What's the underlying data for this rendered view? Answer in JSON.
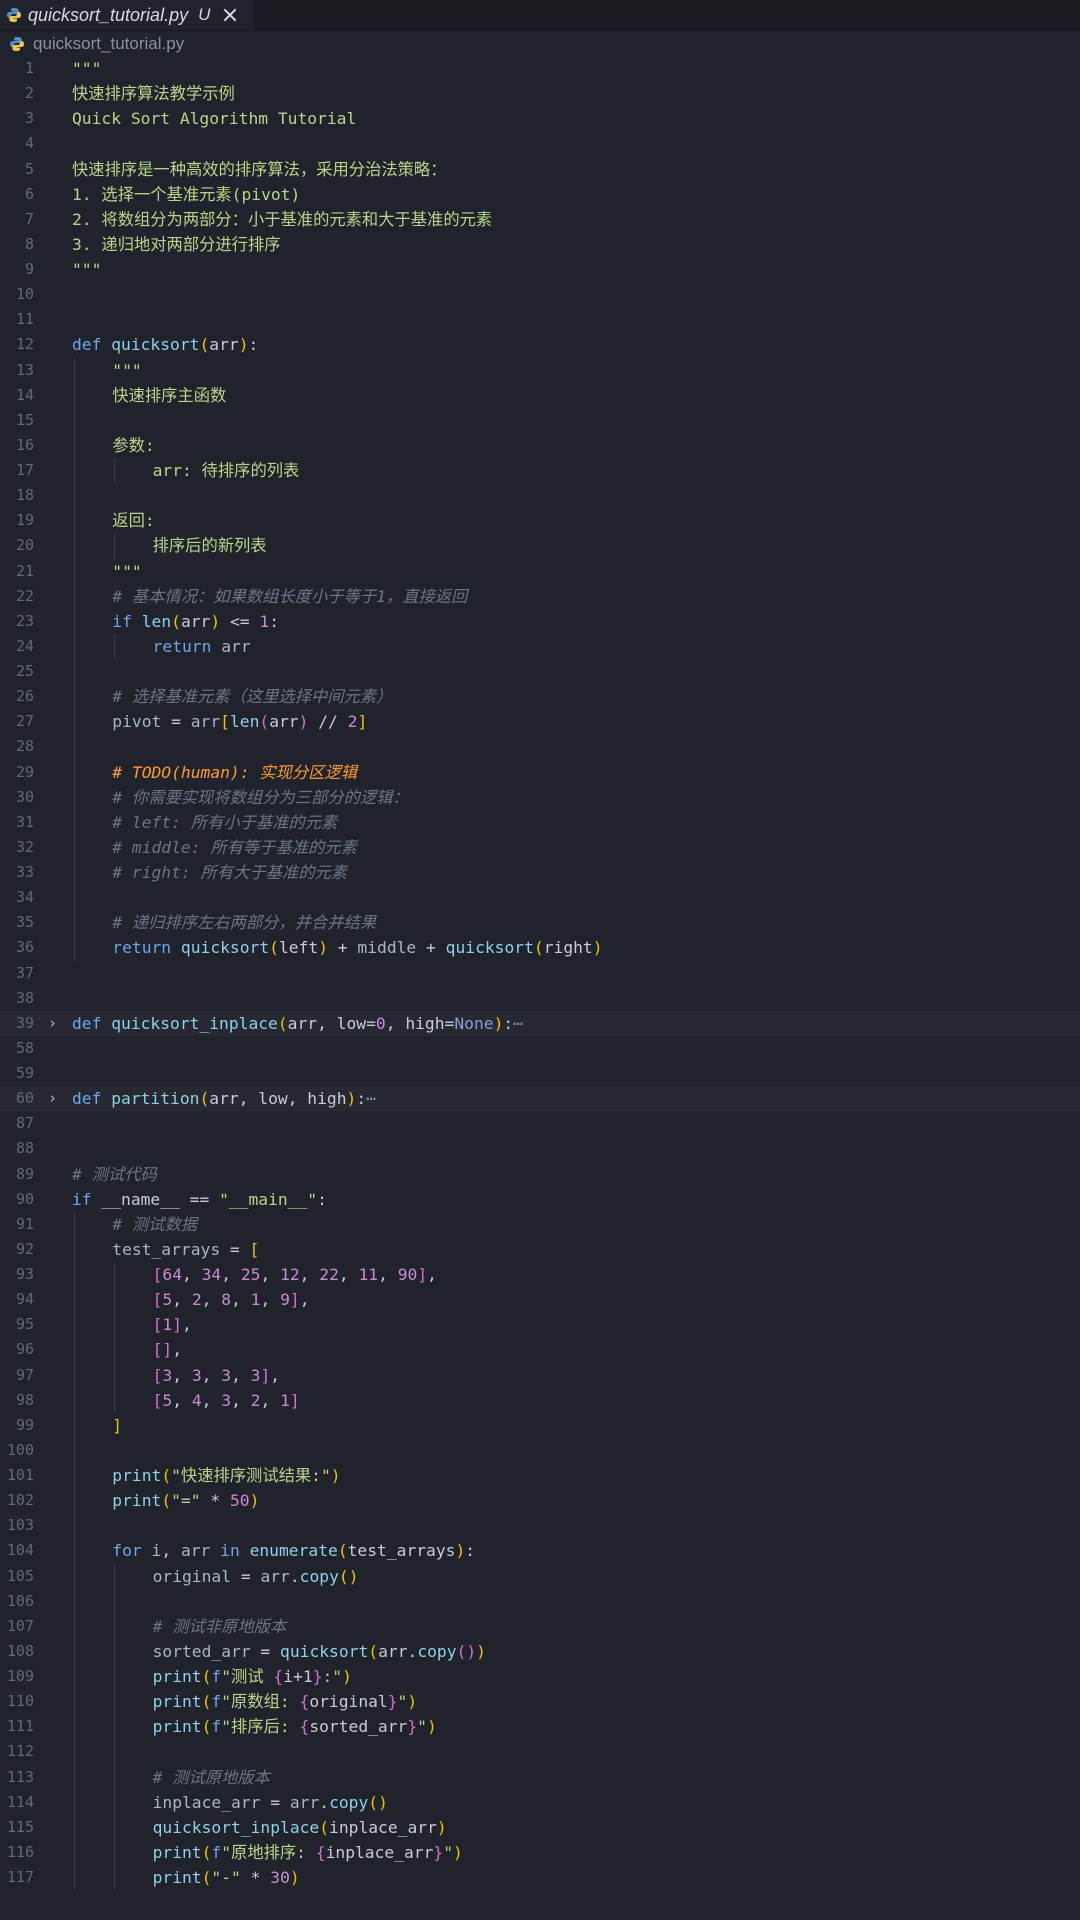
{
  "tab": {
    "filename": "quicksort_tutorial.py",
    "status": "U"
  },
  "breadcrumb": {
    "file": "quicksort_tutorial.py"
  },
  "colors": {
    "background": "#20232b",
    "keyword": "#6fa6e8",
    "function": "#8fd1e6",
    "string": "#b9d58a",
    "number": "#c98bd4",
    "comment": "#6d7587",
    "todo": "#ff9a2e",
    "bracket_level1": "#f0c400",
    "bracket_level2": "#d66fd2"
  },
  "lines": [
    {
      "n": "1",
      "indent": 0,
      "tokens": [
        [
          "str",
          "\"\"\""
        ]
      ]
    },
    {
      "n": "2",
      "indent": 0,
      "tokens": [
        [
          "str",
          "快速排序算法教学示例"
        ]
      ]
    },
    {
      "n": "3",
      "indent": 0,
      "tokens": [
        [
          "str",
          "Quick Sort Algorithm Tutorial"
        ]
      ]
    },
    {
      "n": "4",
      "indent": 0,
      "tokens": []
    },
    {
      "n": "5",
      "indent": 0,
      "tokens": [
        [
          "str",
          "快速排序是一种高效的排序算法，采用分治法策略："
        ]
      ]
    },
    {
      "n": "6",
      "indent": 0,
      "tokens": [
        [
          "str",
          "1. 选择一个基准元素(pivot)"
        ]
      ]
    },
    {
      "n": "7",
      "indent": 0,
      "tokens": [
        [
          "str",
          "2. 将数组分为两部分：小于基准的元素和大于基准的元素"
        ]
      ]
    },
    {
      "n": "8",
      "indent": 0,
      "tokens": [
        [
          "str",
          "3. 递归地对两部分进行排序"
        ]
      ]
    },
    {
      "n": "9",
      "indent": 0,
      "tokens": [
        [
          "str",
          "\"\"\""
        ]
      ]
    },
    {
      "n": "10",
      "indent": 0,
      "tokens": []
    },
    {
      "n": "11",
      "indent": 0,
      "tokens": []
    },
    {
      "n": "12",
      "indent": 0,
      "tokens": [
        [
          "kw",
          "def "
        ],
        [
          "fn",
          "quicksort"
        ],
        [
          "b1",
          "("
        ],
        [
          "id",
          "arr"
        ],
        [
          "b1",
          ")"
        ],
        [
          "id",
          ":"
        ]
      ]
    },
    {
      "n": "13",
      "indent": 1,
      "tokens": [
        [
          "str",
          "\"\"\""
        ]
      ]
    },
    {
      "n": "14",
      "indent": 1,
      "tokens": [
        [
          "str",
          "快速排序主函数"
        ]
      ]
    },
    {
      "n": "15",
      "indent": 1,
      "tokens": []
    },
    {
      "n": "16",
      "indent": 1,
      "tokens": [
        [
          "str",
          "参数:"
        ]
      ]
    },
    {
      "n": "17",
      "indent": 2,
      "tokens": [
        [
          "str",
          "arr: 待排序的列表"
        ]
      ]
    },
    {
      "n": "18",
      "indent": 1,
      "tokens": []
    },
    {
      "n": "19",
      "indent": 1,
      "tokens": [
        [
          "str",
          "返回:"
        ]
      ]
    },
    {
      "n": "20",
      "indent": 2,
      "tokens": [
        [
          "str",
          "排序后的新列表"
        ]
      ]
    },
    {
      "n": "21",
      "indent": 1,
      "tokens": [
        [
          "str",
          "\"\"\""
        ]
      ]
    },
    {
      "n": "22",
      "indent": 1,
      "tokens": [
        [
          "cm",
          "# 基本情况：如果数组长度小于等于1，直接返回"
        ]
      ]
    },
    {
      "n": "23",
      "indent": 1,
      "tokens": [
        [
          "kw",
          "if "
        ],
        [
          "fn",
          "len"
        ],
        [
          "b1",
          "("
        ],
        [
          "id",
          "arr"
        ],
        [
          "b1",
          ")"
        ],
        [
          "op",
          " <= "
        ],
        [
          "num",
          "1"
        ],
        [
          "id",
          ":"
        ]
      ]
    },
    {
      "n": "24",
      "indent": 2,
      "tokens": [
        [
          "kw",
          "return "
        ],
        [
          "var",
          "arr"
        ]
      ]
    },
    {
      "n": "25",
      "indent": 1,
      "tokens": []
    },
    {
      "n": "26",
      "indent": 1,
      "tokens": [
        [
          "cm",
          "# 选择基准元素（这里选择中间元素）"
        ]
      ]
    },
    {
      "n": "27",
      "indent": 1,
      "tokens": [
        [
          "var",
          "pivot"
        ],
        [
          "op",
          " = "
        ],
        [
          "var",
          "arr"
        ],
        [
          "b1",
          "["
        ],
        [
          "fn",
          "len"
        ],
        [
          "b2",
          "("
        ],
        [
          "id",
          "arr"
        ],
        [
          "b2",
          ")"
        ],
        [
          "op",
          " // "
        ],
        [
          "num",
          "2"
        ],
        [
          "b1",
          "]"
        ]
      ]
    },
    {
      "n": "28",
      "indent": 1,
      "tokens": []
    },
    {
      "n": "29",
      "indent": 1,
      "tokens": [
        [
          "todo",
          "# TODO(human): 实现分区逻辑"
        ]
      ]
    },
    {
      "n": "30",
      "indent": 1,
      "tokens": [
        [
          "cm",
          "# 你需要实现将数组分为三部分的逻辑："
        ]
      ]
    },
    {
      "n": "31",
      "indent": 1,
      "tokens": [
        [
          "cm",
          "# left: 所有小于基准的元素"
        ]
      ]
    },
    {
      "n": "32",
      "indent": 1,
      "tokens": [
        [
          "cm",
          "# middle: 所有等于基准的元素"
        ]
      ]
    },
    {
      "n": "33",
      "indent": 1,
      "tokens": [
        [
          "cm",
          "# right: 所有大于基准的元素"
        ]
      ]
    },
    {
      "n": "34",
      "indent": 1,
      "tokens": []
    },
    {
      "n": "35",
      "indent": 1,
      "tokens": [
        [
          "cm",
          "# 递归排序左右两部分，并合并结果"
        ]
      ]
    },
    {
      "n": "36",
      "indent": 1,
      "tokens": [
        [
          "kw",
          "return "
        ],
        [
          "fn",
          "quicksort"
        ],
        [
          "b1",
          "("
        ],
        [
          "id",
          "left"
        ],
        [
          "b1",
          ")"
        ],
        [
          "op",
          " + "
        ],
        [
          "var",
          "middle"
        ],
        [
          "op",
          " + "
        ],
        [
          "fn",
          "quicksort"
        ],
        [
          "b1",
          "("
        ],
        [
          "id",
          "right"
        ],
        [
          "b1",
          ")"
        ]
      ]
    },
    {
      "n": "37",
      "indent": 0,
      "tokens": []
    },
    {
      "n": "38",
      "indent": 0,
      "tokens": []
    },
    {
      "n": "39",
      "indent": 0,
      "fold": true,
      "hl": true,
      "tokens": [
        [
          "kw",
          "def "
        ],
        [
          "fn",
          "quicksort_inplace"
        ],
        [
          "b1",
          "("
        ],
        [
          "id",
          "arr, low"
        ],
        [
          "op",
          "="
        ],
        [
          "num",
          "0"
        ],
        [
          "id",
          ", high"
        ],
        [
          "op",
          "="
        ],
        [
          "none",
          "None"
        ],
        [
          "b1",
          ")"
        ],
        [
          "id",
          ":"
        ],
        [
          "dots",
          "⋯"
        ]
      ]
    },
    {
      "n": "58",
      "indent": 0,
      "tokens": []
    },
    {
      "n": "59",
      "indent": 0,
      "tokens": []
    },
    {
      "n": "60",
      "indent": 0,
      "fold": true,
      "hl": true,
      "tokens": [
        [
          "kw",
          "def "
        ],
        [
          "fn",
          "partition"
        ],
        [
          "b1",
          "("
        ],
        [
          "id",
          "arr, low, high"
        ],
        [
          "b1",
          ")"
        ],
        [
          "id",
          ":"
        ],
        [
          "dots",
          "⋯"
        ]
      ]
    },
    {
      "n": "87",
      "indent": 0,
      "tokens": []
    },
    {
      "n": "88",
      "indent": 0,
      "tokens": []
    },
    {
      "n": "89",
      "indent": 0,
      "tokens": [
        [
          "cm",
          "# 测试代码"
        ]
      ]
    },
    {
      "n": "90",
      "indent": 0,
      "tokens": [
        [
          "kw",
          "if "
        ],
        [
          "id",
          "__name__"
        ],
        [
          "op",
          " == "
        ],
        [
          "str",
          "\"__main__\""
        ],
        [
          "id",
          ":"
        ]
      ]
    },
    {
      "n": "91",
      "indent": 1,
      "tokens": [
        [
          "cm",
          "# 测试数据"
        ]
      ]
    },
    {
      "n": "92",
      "indent": 1,
      "tokens": [
        [
          "var",
          "test_arrays"
        ],
        [
          "op",
          " = "
        ],
        [
          "b1",
          "["
        ]
      ]
    },
    {
      "n": "93",
      "indent": 2,
      "tokens": [
        [
          "b2",
          "["
        ],
        [
          "num",
          "64"
        ],
        [
          "id",
          ", "
        ],
        [
          "num",
          "34"
        ],
        [
          "id",
          ", "
        ],
        [
          "num",
          "25"
        ],
        [
          "id",
          ", "
        ],
        [
          "num",
          "12"
        ],
        [
          "id",
          ", "
        ],
        [
          "num",
          "22"
        ],
        [
          "id",
          ", "
        ],
        [
          "num",
          "11"
        ],
        [
          "id",
          ", "
        ],
        [
          "num",
          "90"
        ],
        [
          "b2",
          "]"
        ],
        [
          "id",
          ","
        ]
      ]
    },
    {
      "n": "94",
      "indent": 2,
      "tokens": [
        [
          "b2",
          "["
        ],
        [
          "num",
          "5"
        ],
        [
          "id",
          ", "
        ],
        [
          "num",
          "2"
        ],
        [
          "id",
          ", "
        ],
        [
          "num",
          "8"
        ],
        [
          "id",
          ", "
        ],
        [
          "num",
          "1"
        ],
        [
          "id",
          ", "
        ],
        [
          "num",
          "9"
        ],
        [
          "b2",
          "]"
        ],
        [
          "id",
          ","
        ]
      ]
    },
    {
      "n": "95",
      "indent": 2,
      "tokens": [
        [
          "b2",
          "["
        ],
        [
          "num",
          "1"
        ],
        [
          "b2",
          "]"
        ],
        [
          "id",
          ","
        ]
      ]
    },
    {
      "n": "96",
      "indent": 2,
      "tokens": [
        [
          "b2",
          "[]"
        ],
        [
          "id",
          ","
        ]
      ]
    },
    {
      "n": "97",
      "indent": 2,
      "tokens": [
        [
          "b2",
          "["
        ],
        [
          "num",
          "3"
        ],
        [
          "id",
          ", "
        ],
        [
          "num",
          "3"
        ],
        [
          "id",
          ", "
        ],
        [
          "num",
          "3"
        ],
        [
          "id",
          ", "
        ],
        [
          "num",
          "3"
        ],
        [
          "b2",
          "]"
        ],
        [
          "id",
          ","
        ]
      ]
    },
    {
      "n": "98",
      "indent": 2,
      "tokens": [
        [
          "b2",
          "["
        ],
        [
          "num",
          "5"
        ],
        [
          "id",
          ", "
        ],
        [
          "num",
          "4"
        ],
        [
          "id",
          ", "
        ],
        [
          "num",
          "3"
        ],
        [
          "id",
          ", "
        ],
        [
          "num",
          "2"
        ],
        [
          "id",
          ", "
        ],
        [
          "num",
          "1"
        ],
        [
          "b2",
          "]"
        ]
      ]
    },
    {
      "n": "99",
      "indent": 1,
      "tokens": [
        [
          "b1",
          "]"
        ]
      ]
    },
    {
      "n": "100",
      "indent": 1,
      "tokens": []
    },
    {
      "n": "101",
      "indent": 1,
      "tokens": [
        [
          "fn",
          "print"
        ],
        [
          "b1",
          "("
        ],
        [
          "str",
          "\"快速排序测试结果:\""
        ],
        [
          "b1",
          ")"
        ]
      ]
    },
    {
      "n": "102",
      "indent": 1,
      "tokens": [
        [
          "fn",
          "print"
        ],
        [
          "b1",
          "("
        ],
        [
          "str",
          "\"=\""
        ],
        [
          "op",
          " * "
        ],
        [
          "num",
          "50"
        ],
        [
          "b1",
          ")"
        ]
      ]
    },
    {
      "n": "103",
      "indent": 1,
      "tokens": []
    },
    {
      "n": "104",
      "indent": 1,
      "tokens": [
        [
          "kw",
          "for "
        ],
        [
          "var",
          "i"
        ],
        [
          "id",
          ", "
        ],
        [
          "var",
          "arr"
        ],
        [
          "kw",
          " in "
        ],
        [
          "fn",
          "enumerate"
        ],
        [
          "b1",
          "("
        ],
        [
          "id",
          "test_arrays"
        ],
        [
          "b1",
          ")"
        ],
        [
          "id",
          ":"
        ]
      ]
    },
    {
      "n": "105",
      "indent": 2,
      "tokens": [
        [
          "var",
          "original"
        ],
        [
          "op",
          " = "
        ],
        [
          "var",
          "arr"
        ],
        [
          "id",
          "."
        ],
        [
          "fn",
          "copy"
        ],
        [
          "b1",
          "()"
        ]
      ]
    },
    {
      "n": "106",
      "indent": 2,
      "tokens": []
    },
    {
      "n": "107",
      "indent": 2,
      "tokens": [
        [
          "cm",
          "# 测试非原地版本"
        ]
      ]
    },
    {
      "n": "108",
      "indent": 2,
      "tokens": [
        [
          "var",
          "sorted_arr"
        ],
        [
          "op",
          " = "
        ],
        [
          "fn",
          "quicksort"
        ],
        [
          "b1",
          "("
        ],
        [
          "id",
          "arr"
        ],
        [
          "id",
          "."
        ],
        [
          "fn",
          "copy"
        ],
        [
          "b2",
          "()"
        ],
        [
          "b1",
          ")"
        ]
      ]
    },
    {
      "n": "109",
      "indent": 2,
      "tokens": [
        [
          "fn",
          "print"
        ],
        [
          "b1",
          "("
        ],
        [
          "kw",
          "f"
        ],
        [
          "str",
          "\"测试 "
        ],
        [
          "b2",
          "{"
        ],
        [
          "id",
          "i+1"
        ],
        [
          "b2",
          "}"
        ],
        [
          "str",
          ":\""
        ],
        [
          "b1",
          ")"
        ]
      ]
    },
    {
      "n": "110",
      "indent": 2,
      "tokens": [
        [
          "fn",
          "print"
        ],
        [
          "b1",
          "("
        ],
        [
          "kw",
          "f"
        ],
        [
          "str",
          "\"原数组: "
        ],
        [
          "b2",
          "{"
        ],
        [
          "id",
          "original"
        ],
        [
          "b2",
          "}"
        ],
        [
          "str",
          "\""
        ],
        [
          "b1",
          ")"
        ]
      ]
    },
    {
      "n": "111",
      "indent": 2,
      "tokens": [
        [
          "fn",
          "print"
        ],
        [
          "b1",
          "("
        ],
        [
          "kw",
          "f"
        ],
        [
          "str",
          "\"排序后: "
        ],
        [
          "b2",
          "{"
        ],
        [
          "id",
          "sorted_arr"
        ],
        [
          "b2",
          "}"
        ],
        [
          "str",
          "\""
        ],
        [
          "b1",
          ")"
        ]
      ]
    },
    {
      "n": "112",
      "indent": 2,
      "tokens": []
    },
    {
      "n": "113",
      "indent": 2,
      "tokens": [
        [
          "cm",
          "# 测试原地版本"
        ]
      ]
    },
    {
      "n": "114",
      "indent": 2,
      "tokens": [
        [
          "var",
          "inplace_arr"
        ],
        [
          "op",
          " = "
        ],
        [
          "var",
          "arr"
        ],
        [
          "id",
          "."
        ],
        [
          "fn",
          "copy"
        ],
        [
          "b1",
          "()"
        ]
      ]
    },
    {
      "n": "115",
      "indent": 2,
      "tokens": [
        [
          "fn",
          "quicksort_inplace"
        ],
        [
          "b1",
          "("
        ],
        [
          "id",
          "inplace_arr"
        ],
        [
          "b1",
          ")"
        ]
      ]
    },
    {
      "n": "116",
      "indent": 2,
      "tokens": [
        [
          "fn",
          "print"
        ],
        [
          "b1",
          "("
        ],
        [
          "kw",
          "f"
        ],
        [
          "str",
          "\"原地排序: "
        ],
        [
          "b2",
          "{"
        ],
        [
          "id",
          "inplace_arr"
        ],
        [
          "b2",
          "}"
        ],
        [
          "str",
          "\""
        ],
        [
          "b1",
          ")"
        ]
      ]
    },
    {
      "n": "117",
      "indent": 2,
      "tokens": [
        [
          "fn",
          "print"
        ],
        [
          "b1",
          "("
        ],
        [
          "str",
          "\"-\""
        ],
        [
          "op",
          " * "
        ],
        [
          "num",
          "30"
        ],
        [
          "b1",
          ")"
        ]
      ]
    }
  ]
}
